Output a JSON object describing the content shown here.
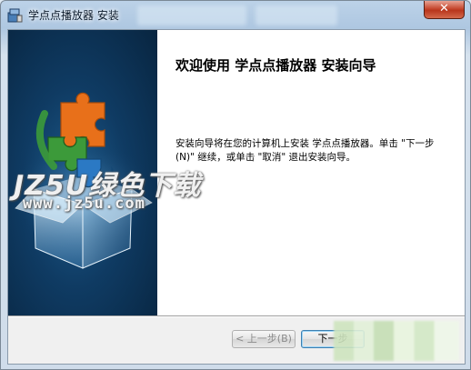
{
  "window": {
    "title": "学点点播放器 安装",
    "close_label": "✕"
  },
  "content": {
    "heading": "欢迎使用 学点点播放器 安装向导",
    "body": "安装向导将在您的计算机上安装 学点点播放器。单击 \"下一步(N)\" 继续，或单击 \"取消\" 退出安装向导。"
  },
  "watermark": {
    "brand": "JZ5U绿色下载",
    "url": "www.jz5u.com"
  },
  "buttons": {
    "back": "< 上一步(B)",
    "next": "下一步"
  },
  "colors": {
    "banner_bg": "#0f3b63",
    "accent_orange": "#e8701a",
    "accent_green": "#3c9a3a",
    "accent_blue": "#2b79c4"
  },
  "icons": {
    "title_icon": "installer-icon",
    "banner_graphic": "puzzle-box-icon"
  }
}
